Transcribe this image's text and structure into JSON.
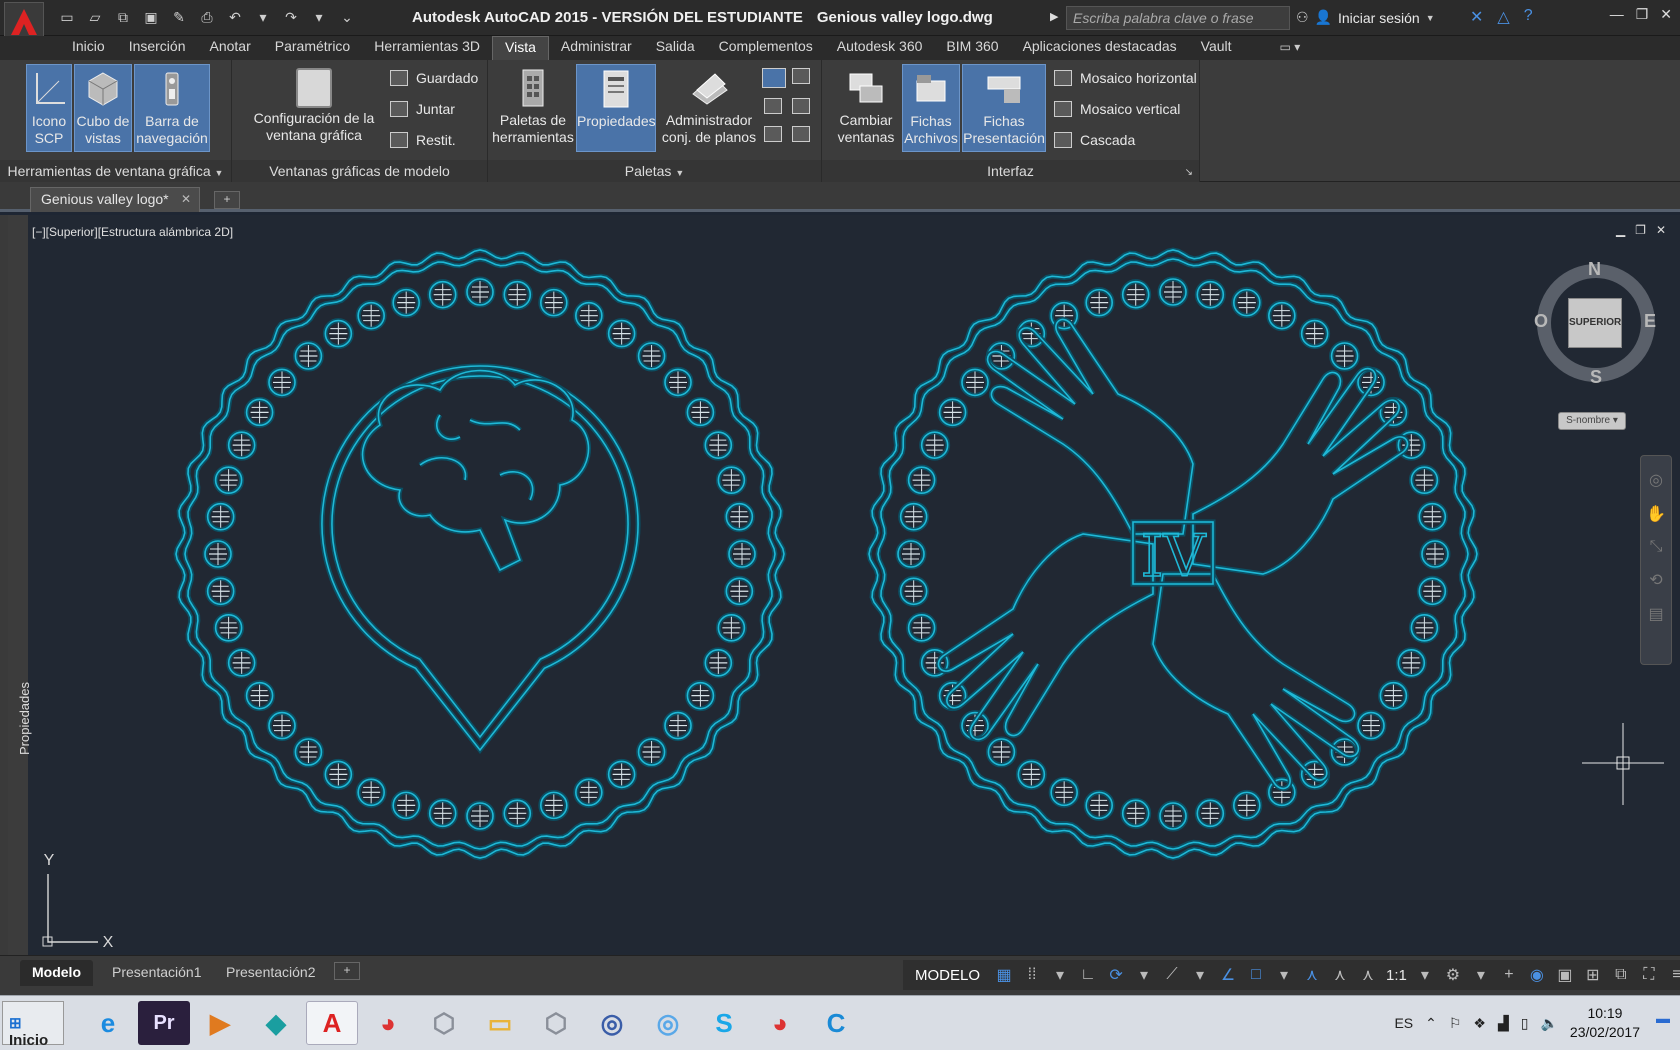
{
  "titlebar": {
    "app_title": "Autodesk AutoCAD 2015 - VERSIÓN DEL ESTUDIANTE",
    "file_name": "Genious valley logo.dwg",
    "search_placeholder": "Escriba palabra clave o frase",
    "signin_label": "Iniciar sesión"
  },
  "ribbon_tabs": [
    "Inicio",
    "Inserción",
    "Anotar",
    "Paramétrico",
    "Herramientas 3D",
    "Vista",
    "Administrar",
    "Salida",
    "Complementos",
    "Autodesk 360",
    "BIM 360",
    "Aplicaciones destacadas",
    "Vault"
  ],
  "active_tab": "Vista",
  "panels": {
    "viewport_tools": {
      "title": "Herramientas de ventana gráfica",
      "btn_ucs": "Icono SCP",
      "btn_viewcube": "Cubo de vistas",
      "btn_navbar": "Barra de navegación"
    },
    "model_viewports": {
      "title": "Ventanas gráficas de modelo",
      "btn_config": "Configuración de la ventana gráfica",
      "btn_saved": "Guardado",
      "btn_join": "Juntar",
      "btn_restore": "Restit."
    },
    "palettes": {
      "title": "Paletas",
      "btn_tool_palettes": "Paletas de herramientas",
      "btn_properties": "Propiedades",
      "btn_sheetset": "Administrador conj. de planos"
    },
    "interface": {
      "title": "Interfaz",
      "btn_switch": "Cambiar ventanas",
      "btn_file_tabs": "Fichas Archivos",
      "btn_layout_tabs": "Fichas Presentación",
      "btn_tile_h": "Mosaico horizontal",
      "btn_tile_v": "Mosaico vertical",
      "btn_cascade": "Cascada"
    }
  },
  "doc_tab": "Genious valley logo*",
  "viewport_label": "[−][Superior][Estructura alámbrica 2D]",
  "side_palette_label": "Propiedades",
  "viewcube": {
    "n": "N",
    "s": "S",
    "e": "E",
    "w": "O",
    "face": "SUPERIOR",
    "wcs": "S-nombre"
  },
  "ucs_axes": {
    "x": "X",
    "y": "Y"
  },
  "drawing": {
    "left_medallion": {
      "type": "brain-in-location-pin",
      "ring_markers": 44
    },
    "right_medallion": {
      "type": "four-hands",
      "center_text": "IV",
      "ring_markers": 44
    },
    "stroke_color": "#1fb8d6"
  },
  "layout_tabs": [
    "Modelo",
    "Presentación1",
    "Presentación2"
  ],
  "active_layout": "Modelo",
  "status": {
    "mode": "MODELO",
    "scale": "1:1"
  },
  "taskbar": {
    "start_label": "Inicio",
    "apps": [
      "internet-explorer",
      "premiere",
      "media-player",
      "3ds-max",
      "autocad",
      "chrome",
      "app-3d",
      "file-explorer",
      "app-3d-2",
      "app-ring",
      "app-ring-2",
      "skype",
      "chrome-2",
      "app-c"
    ],
    "language": "ES",
    "time": "10:19",
    "date": "23/02/2017"
  }
}
